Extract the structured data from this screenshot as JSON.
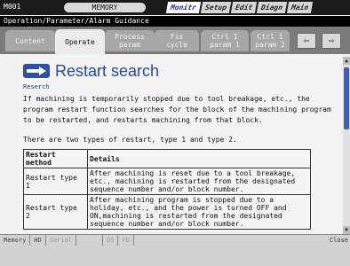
{
  "topbar": {
    "program": "M001",
    "mode": "MEMORY",
    "menus": [
      "Monitr",
      "Setup",
      "Edit",
      "Diagn",
      "Main"
    ]
  },
  "titlebar": "Operation/Parameter/Alarm Guidance",
  "tabs": [
    {
      "label": "Content"
    },
    {
      "label": "Operate"
    },
    {
      "label": "Process\nparam"
    },
    {
      "label": "Fix\ncycle"
    },
    {
      "label": "Ctrl 1\nparam 1"
    },
    {
      "label": "Ctrl 1\nparam 2"
    }
  ],
  "nav": {
    "prev": "⇦",
    "next": "⇨"
  },
  "help": {
    "title": "Restart search",
    "subtitle": "Reserch",
    "paragraph1": "If machining is temporarily stopped due to tool breakage, etc., the program restart function searches for the block of the machining program to be restarted, and restarts machining from that block.",
    "paragraph2": "There are two types of restart, type 1 and type 2."
  },
  "table": {
    "headers": [
      "Restart method",
      "Details"
    ],
    "rows": [
      {
        "method": "Restart type 1",
        "details": "After machining is reset due to a tool breakage, etc., machining is restarted from the designated sequence number and/or block number."
      },
      {
        "method": "Restart type 2",
        "details": "After machining program is stopped due to a holiday, etc., and the power is turned OFF and ON,machining is restarted from the designated sequence number and/or block number."
      }
    ]
  },
  "status": {
    "cells": [
      "Memory",
      "HD",
      "Serial",
      "",
      "DS",
      "FD"
    ],
    "close": "Close"
  }
}
